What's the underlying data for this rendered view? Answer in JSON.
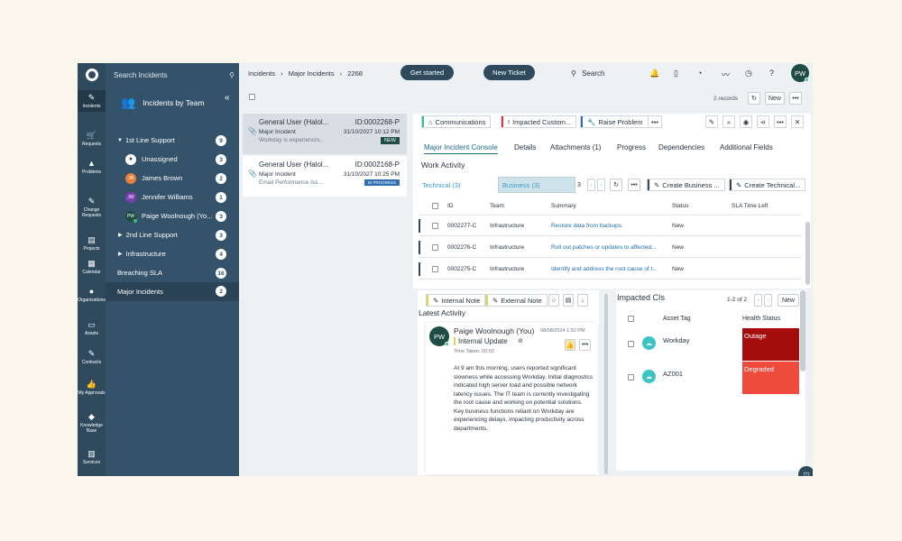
{
  "rail": {
    "items": [
      {
        "icon": "✎",
        "label": "Incidents"
      },
      {
        "icon": "🛒",
        "label": "Requests"
      },
      {
        "icon": "▲",
        "label": "Problems"
      },
      {
        "icon": "✎",
        "label": "Change Requests"
      },
      {
        "icon": "▤",
        "label": "Projects"
      },
      {
        "icon": "▦",
        "label": "Calendar"
      },
      {
        "icon": "●",
        "label": "Organizations"
      },
      {
        "icon": "▭",
        "label": "Assets"
      },
      {
        "icon": "✎",
        "label": "Contracts"
      },
      {
        "icon": "👍",
        "label": "My Approvals"
      },
      {
        "icon": "◆",
        "label": "Knowledge Base"
      },
      {
        "icon": "▥",
        "label": "Services"
      }
    ]
  },
  "panel": {
    "search_placeholder": "Search Incidents",
    "header": "Incidents by Team",
    "rows": [
      {
        "label": "1st Line Support",
        "count": "9"
      },
      {
        "label": "Unassigned",
        "count": "3",
        "initials": ""
      },
      {
        "label": "James Brown",
        "count": "2",
        "initials": "JB"
      },
      {
        "label": "Jennifer Williams",
        "count": "1",
        "initials": "JW"
      },
      {
        "label": "Paige Woolnough (Yo...",
        "count": "3",
        "initials": "PW"
      },
      {
        "label": "2nd Line Support",
        "count": "3"
      },
      {
        "label": "Infrastructure",
        "count": "4"
      },
      {
        "label": "Breaching SLA",
        "count": "16"
      },
      {
        "label": "Major Incidents",
        "count": "2"
      }
    ]
  },
  "topbar": {
    "breadcrumb": [
      "Incidents",
      "Major Incidents",
      "2268"
    ],
    "get_started": "Get started",
    "new_ticket": "New Ticket",
    "search": "Search",
    "avatar": "PW"
  },
  "list_toolbar": {
    "records": "2 records",
    "new": "New"
  },
  "tickets": [
    {
      "title": "General User (Halol...",
      "id": "ID:0002268-P",
      "type": "Major Incident",
      "date": "31/10/2027 10:12 PM",
      "summary": "Workday is experiencin...",
      "status": "NEW"
    },
    {
      "title": "General User (Halol...",
      "id": "ID:0002168-P",
      "type": "Major Incident",
      "date": "31/10/2027 10:25 PM",
      "summary": "Email Performance Iss...",
      "status": "IN PROGRESS"
    }
  ],
  "detail": {
    "actions": [
      "Communications",
      "Impacted Custom...",
      "Raise Problem"
    ],
    "tabs": [
      "Major Incident Console",
      "Details",
      "Attachments (1)",
      "Progress",
      "Dependencies",
      "Additional Fields"
    ],
    "work_activity": {
      "title": "Work Activity",
      "technical_tab": "Technical (3)",
      "business_tab": "Business (3)",
      "count": "3",
      "create_business": "Create Business ...",
      "create_technical": "Create Technical...",
      "columns": [
        "ID",
        "Team",
        "Summary",
        "Status",
        "SLA Time Left"
      ],
      "rows": [
        {
          "id": "0002277-C",
          "team": "Infrastructure",
          "summary": "Restore data from backups.",
          "status": "New"
        },
        {
          "id": "0002276-C",
          "team": "Infrastructure",
          "summary": "Roll out patches or updates to affected...",
          "status": "New"
        },
        {
          "id": "0002275-C",
          "team": "Infrastructure",
          "summary": "Identify and address the root cause of t...",
          "status": "New"
        }
      ]
    },
    "latest": {
      "internal_note": "Internal Note",
      "external_note": "External Note",
      "title": "Latest Activity",
      "author": "Paige Woolnough (You)",
      "date": "08/08/2024 1:32 PM",
      "kind": "Internal Update",
      "time_taken": "Time Taken: 00:02",
      "body": "At 9 am this morning, users reported significant slowness while accessing Workday. Initial diagnostics indicated high server load and possible network latency issues. The IT team is currently investigating the root cause and working on potential solutions. Key business functions reliant on Workday are experiencing delays, impacting productivity across departments.",
      "avatar": "PW"
    },
    "impacted": {
      "title": "Impacted CIs",
      "paging": "1-2 of 2",
      "new": "New",
      "columns": [
        "Asset Tag",
        "Health Status"
      ],
      "rows": [
        {
          "tag": "Workday",
          "status": "Outage",
          "color": "#a50d0d"
        },
        {
          "tag": "AZ001",
          "status": "Degraded",
          "color": "#ee4b3c"
        }
      ]
    }
  }
}
